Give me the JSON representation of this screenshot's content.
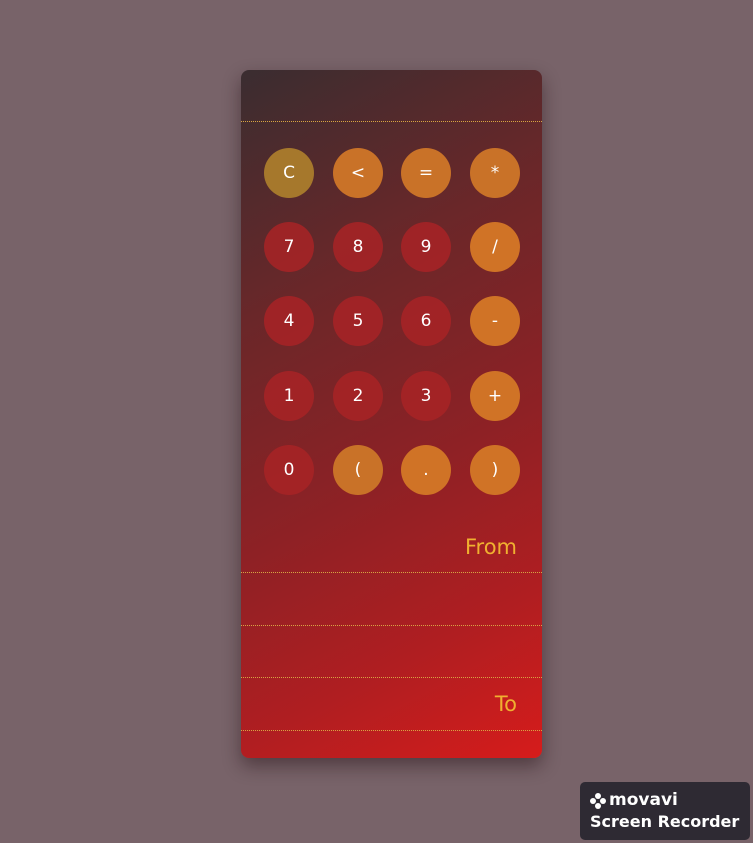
{
  "keypad": {
    "rows": [
      [
        "C",
        "<",
        "=",
        "*"
      ],
      [
        "7",
        "8",
        "9",
        "/"
      ],
      [
        "4",
        "5",
        "6",
        "-"
      ],
      [
        "1",
        "2",
        "3",
        "+"
      ],
      [
        "0",
        "(",
        ".",
        ")"
      ]
    ]
  },
  "fields": {
    "from_label": "From",
    "to_label": "To"
  },
  "watermark": {
    "brand": "movavi",
    "product": "Screen Recorder"
  },
  "colors": {
    "page_bg": "#786369",
    "accent": "#f0b030",
    "number_key": "#a82326",
    "operator_key": "#c97228",
    "clear_key": "#a6782c"
  }
}
